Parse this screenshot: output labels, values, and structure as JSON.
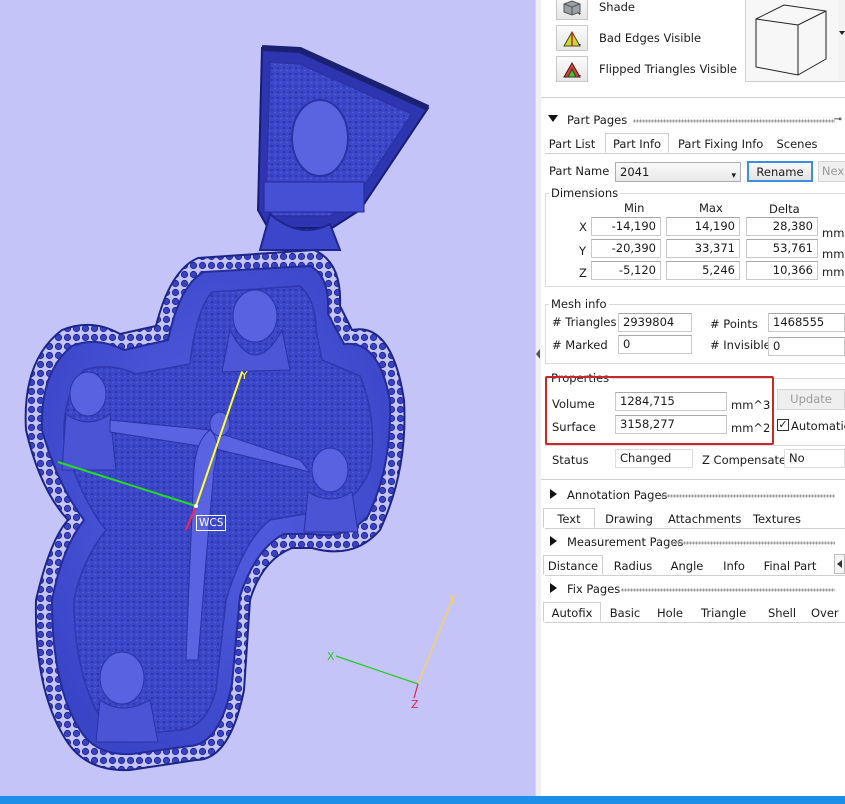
{
  "viewport": {
    "wcs_label": "WCS",
    "axis_y_label": "Y",
    "triad_y": "Y",
    "triad_x": "X",
    "triad_z": "Z",
    "model_colors": {
      "fill": "#4a55d8",
      "edge": "#2b33a8",
      "background": "#c4c4f8"
    }
  },
  "view_buttons": [
    {
      "label": "Shade",
      "icon": "shade-cube-icon"
    },
    {
      "label": "Bad Edges Visible",
      "icon": "bad-edges-triangle-icon"
    },
    {
      "label": "Flipped Triangles Visible",
      "icon": "flipped-triangles-icon"
    }
  ],
  "part_pages": {
    "header": "Part Pages",
    "tabs": [
      "Part List",
      "Part Info",
      "Part Fixing Info",
      "Scenes"
    ],
    "active_tab": "Part Info",
    "part_name_label": "Part Name",
    "part_name_value": "2041",
    "rename_label": "Rename",
    "next_label": "Nex"
  },
  "dimensions": {
    "title": "Dimensions",
    "columns": [
      "Min",
      "Max",
      "Delta"
    ],
    "rows": [
      {
        "axis": "X",
        "min": "-14,190",
        "max": "14,190",
        "delta": "28,380",
        "unit": "mm"
      },
      {
        "axis": "Y",
        "min": "-20,390",
        "max": "33,371",
        "delta": "53,761",
        "unit": "mm"
      },
      {
        "axis": "Z",
        "min": "-5,120",
        "max": "5,246",
        "delta": "10,366",
        "unit": "mm"
      }
    ]
  },
  "mesh_info": {
    "title": "Mesh info",
    "triangles_label": "# Triangles",
    "triangles_value": "2939804",
    "points_label": "# Points",
    "points_value": "1468555",
    "marked_label": "# Marked",
    "marked_value": "0",
    "invisible_label": "# Invisible",
    "invisible_value": "0"
  },
  "properties": {
    "title": "Properties",
    "volume_label": "Volume",
    "volume_value": "1284,715",
    "volume_unit": "mm^3",
    "surface_label": "Surface",
    "surface_value": "3158,277",
    "surface_unit": "mm^2",
    "update_label": "Update",
    "automatic_label": "Automatic",
    "automatic_checked": true,
    "highlight_color": "#c8282a"
  },
  "status": {
    "status_label": "Status",
    "status_value": "Changed",
    "zcomp_label": "Z Compensated",
    "zcomp_value": "No"
  },
  "annotation_pages": {
    "header": "Annotation Pages",
    "tabs": [
      "Text",
      "Drawing",
      "Attachments",
      "Textures"
    ],
    "active_tab": "Text"
  },
  "measurement_pages": {
    "header": "Measurement Pages",
    "tabs": [
      "Distance",
      "Radius",
      "Angle",
      "Info",
      "Final Part"
    ],
    "active_tab": "Distance"
  },
  "fix_pages": {
    "header": "Fix Pages",
    "tabs": [
      "Autofix",
      "Basic",
      "Hole",
      "Triangle",
      "Shell",
      "Over"
    ],
    "active_tab": "Autofix"
  },
  "accent_color": "#1e8fe8"
}
